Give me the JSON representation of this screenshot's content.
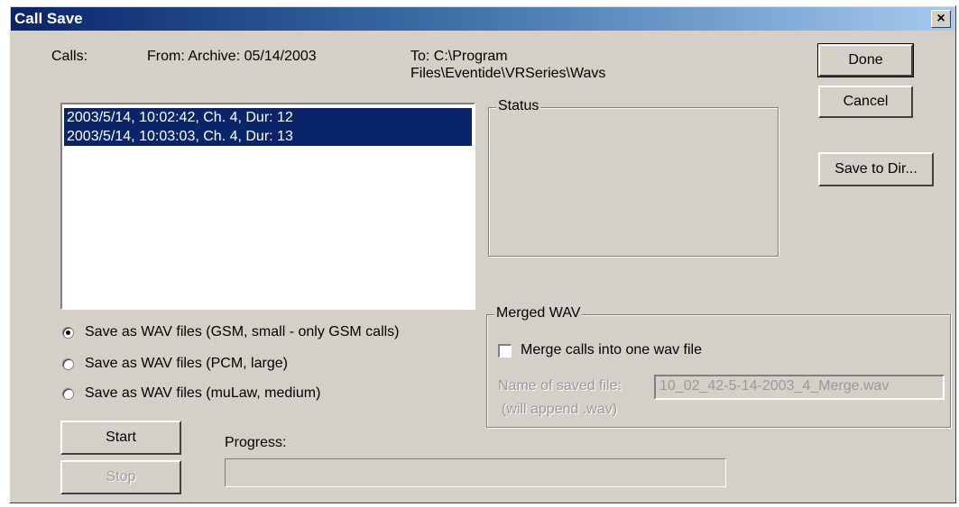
{
  "window": {
    "title": "Call Save",
    "close_glyph": "×"
  },
  "header": {
    "calls_label": "Calls:",
    "from_text": "From: Archive: 05/14/2003",
    "to_line1": "To: C:\\Program",
    "to_line2": "Files\\Eventide\\VRSeries\\Wavs"
  },
  "calls_list": {
    "items": [
      "2003/5/14, 10:02:42, Ch. 4, Dur: 12",
      "2003/5/14, 10:03:03, Ch. 4, Dur: 13"
    ]
  },
  "status_group": {
    "label": "Status"
  },
  "buttons": {
    "done": "Done",
    "cancel": "Cancel",
    "save_to_dir": "Save to Dir...",
    "start": "Start",
    "stop": "Stop"
  },
  "save_options": [
    {
      "label": "Save as WAV files (GSM, small - only GSM calls)",
      "checked": true
    },
    {
      "label": "Save as WAV files (PCM, large)",
      "checked": false
    },
    {
      "label": "Save as WAV files (muLaw, medium)",
      "checked": false
    }
  ],
  "merged_wav": {
    "group_label": "Merged WAV",
    "checkbox_label": "Merge calls into one wav file",
    "checkbox_checked": false,
    "name_label": "Name of saved file:",
    "name_value": "10_02_42-5-14-2003_4_Merge.wav",
    "append_note": "(will append .wav)"
  },
  "progress": {
    "label": "Progress:",
    "value": 0
  },
  "colors": {
    "dialog_face": "#d4d0c8",
    "title_gradient_start": "#0a246a",
    "title_gradient_end": "#a6caf0",
    "selection": "#0a246a"
  },
  "icons": {
    "close": "close-icon"
  }
}
